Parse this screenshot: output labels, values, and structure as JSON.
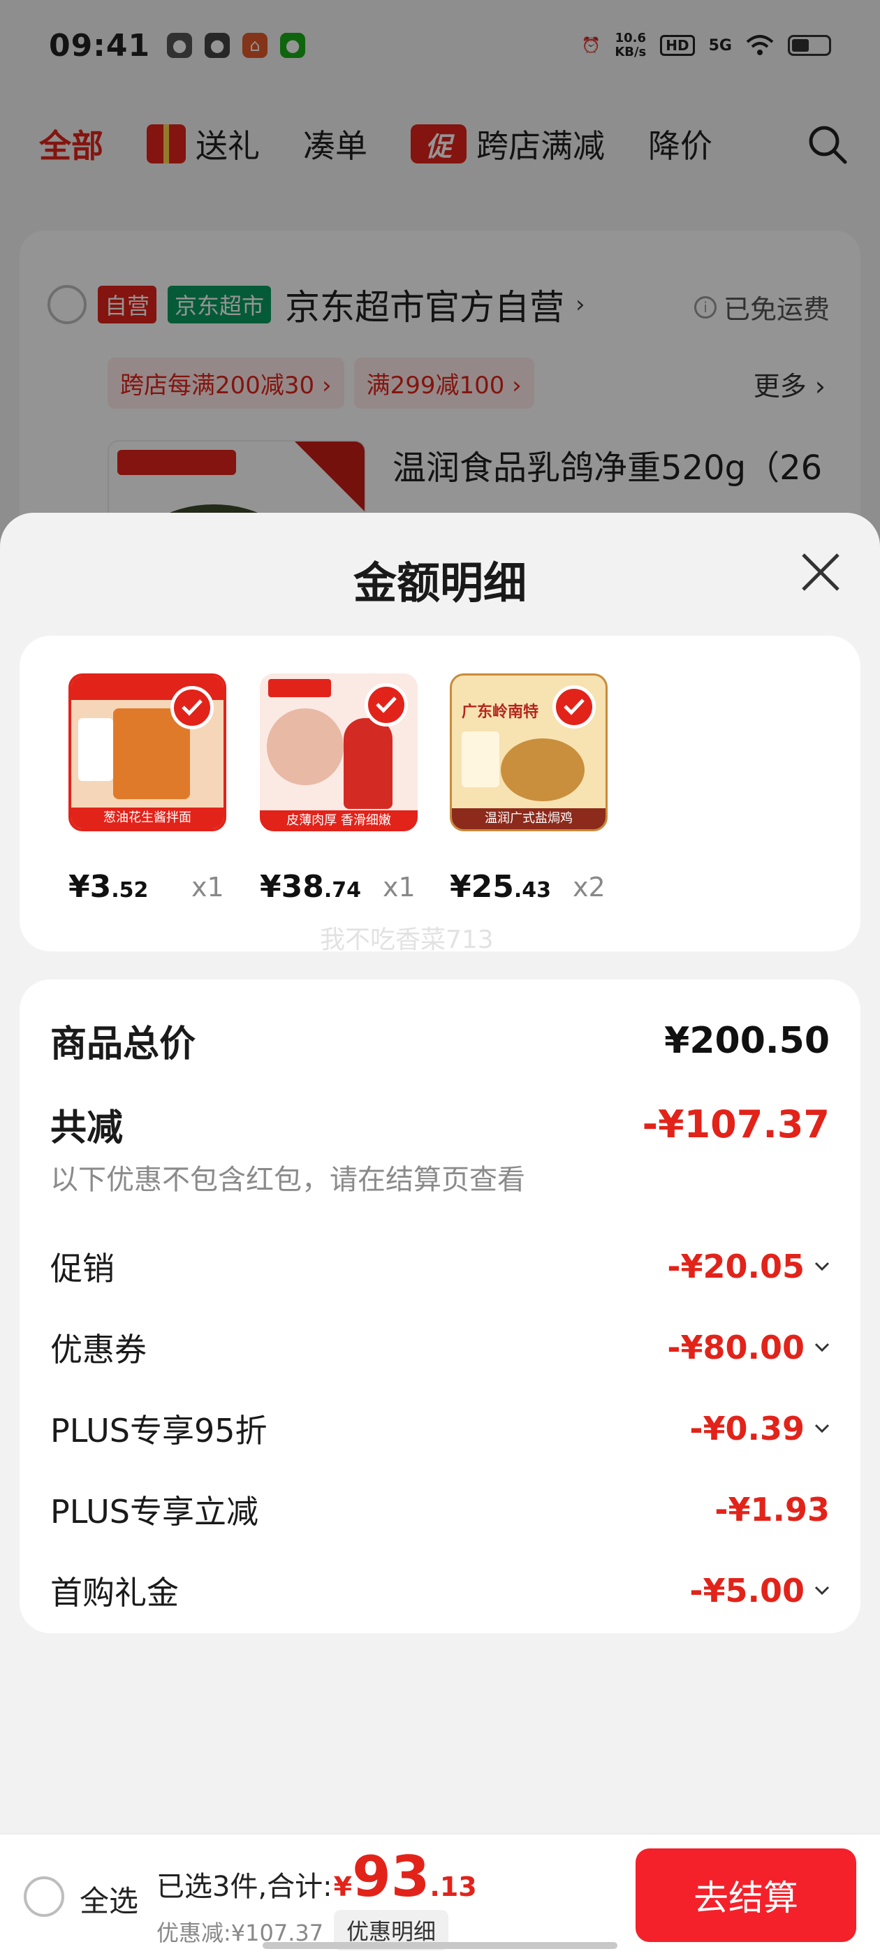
{
  "status_bar": {
    "time": "09:41",
    "speed": "10.6",
    "speed_unit": "KB/s",
    "hd": "HD",
    "network": "5G"
  },
  "top_tabs": [
    {
      "label": "全部",
      "active": true
    },
    {
      "label": "送礼",
      "icon": "gift-icon"
    },
    {
      "label": "凑单"
    },
    {
      "label": "跨店满减",
      "badge": "促"
    },
    {
      "label": "降价"
    }
  ],
  "store": {
    "tag_self": "自营",
    "tag_channel": "京东超市",
    "name": "京东超市官方自营",
    "shipping": "已免运费",
    "promos": [
      "跨店每满200减30",
      "满299减100"
    ],
    "more": "更多",
    "item_title": "温润食品乳鸽净重520g（26"
  },
  "sheet": {
    "title": "金额明细",
    "products": [
      {
        "price_int": "¥3",
        "price_dec": ".52",
        "qty": "x1",
        "caption": "葱油花生酱拌面"
      },
      {
        "price_int": "¥38",
        "price_dec": ".74",
        "qty": "x1",
        "caption": "皮薄肉厚 香滑细嫩"
      },
      {
        "price_int": "¥25",
        "price_dec": ".43",
        "qty": "x2",
        "caption": "温润广式盐焗鸡",
        "banner": "广东岭南特"
      }
    ],
    "watermark": "我不吃香菜713",
    "rows": {
      "total_label": "商品总价",
      "total_value": "¥200.50",
      "reduce_label": "共减",
      "reduce_value": "-¥107.37",
      "note": "以下优惠不包含红包，请在结算页查看",
      "items": [
        {
          "label": "促销",
          "value": "-¥20.05",
          "has_chevron": true
        },
        {
          "label": "优惠券",
          "value": "-¥80.00",
          "has_chevron": true
        },
        {
          "label": "PLUS专享95折",
          "value": "-¥0.39",
          "has_chevron": true
        },
        {
          "label": "PLUS专享立减",
          "value": "-¥1.93",
          "has_chevron": false
        },
        {
          "label": "首购礼金",
          "value": "-¥5.00",
          "has_chevron": true
        }
      ]
    }
  },
  "bottom_bar": {
    "select_all": "全选",
    "selected_text": "已选3件,合计:",
    "total_yen": "¥",
    "total_int": "93",
    "total_dec": ".13",
    "discount_text": "优惠减:¥107.37",
    "detail_button": "优惠明细",
    "checkout_button": "去结算"
  },
  "colors": {
    "accent": "#e2231a",
    "checkout": "#f4212a",
    "green_tag": "#0a9e61"
  }
}
